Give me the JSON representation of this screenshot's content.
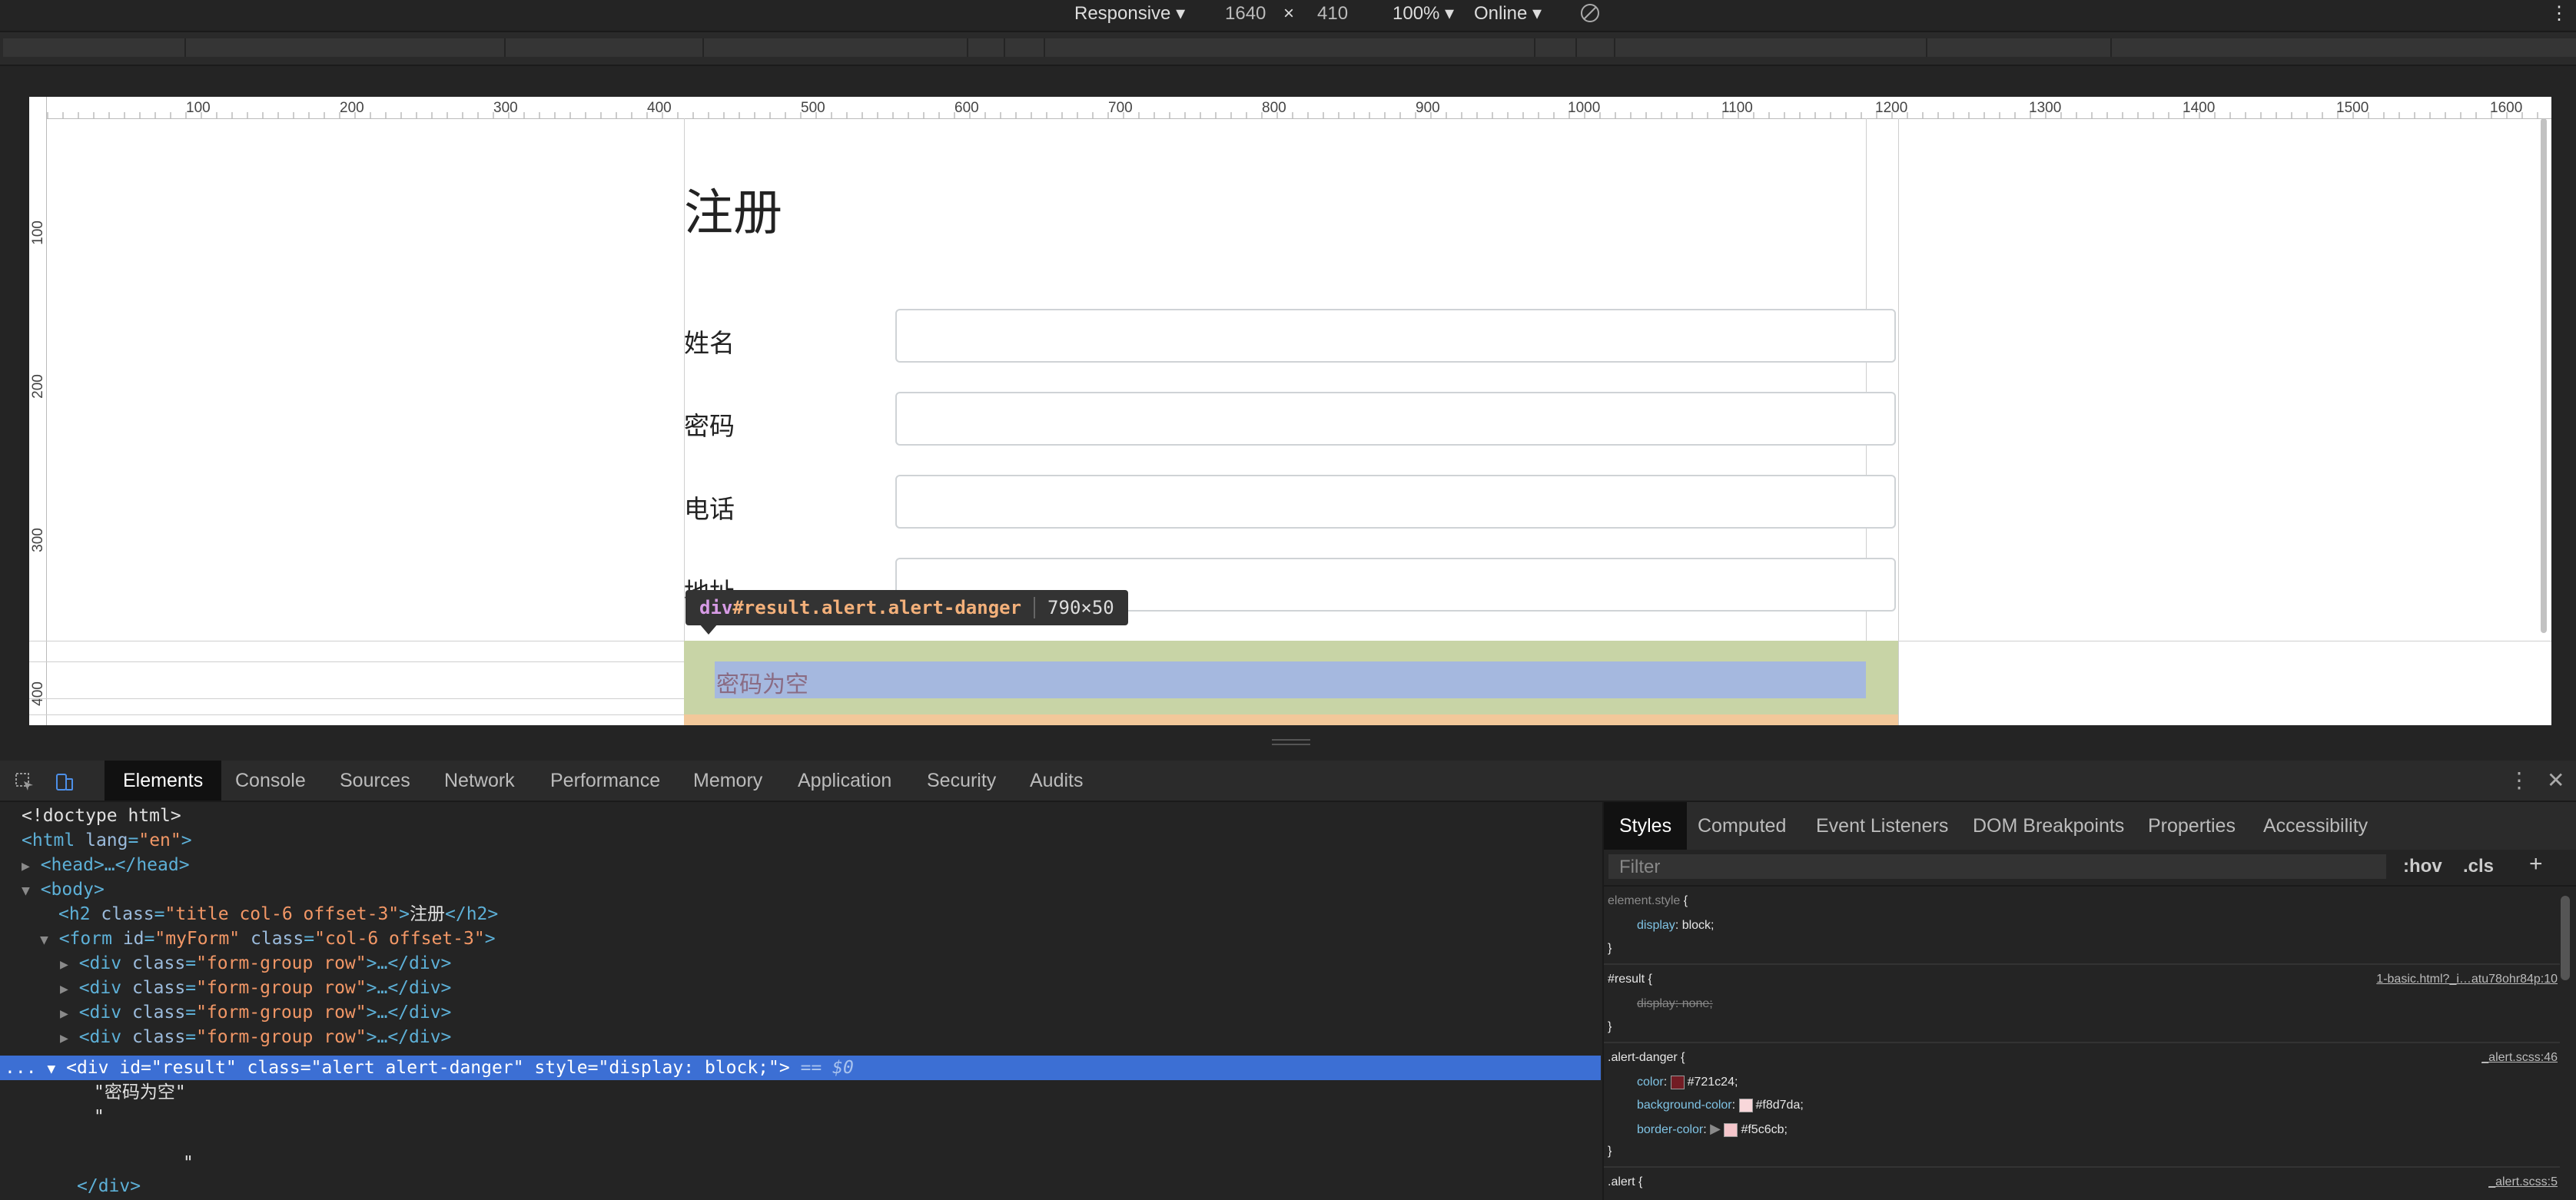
{
  "device_toolbar": {
    "device": "Responsive ▾",
    "width": "1640",
    "times": "×",
    "height": "410",
    "zoom": "100% ▾",
    "network": "Online ▾",
    "more_icon": "⋮"
  },
  "ruler": {
    "top_labels": [
      "100",
      "200",
      "300",
      "400",
      "500",
      "600",
      "700",
      "800",
      "900",
      "1000",
      "1100",
      "1200",
      "1300",
      "1400",
      "1500",
      "1600"
    ],
    "left_labels": [
      "100",
      "200",
      "300",
      "400"
    ]
  },
  "page": {
    "title": "注册",
    "fields": [
      {
        "label": "姓名"
      },
      {
        "label": "密码"
      },
      {
        "label": "电话"
      },
      {
        "label": "地址"
      }
    ],
    "alert_text": "密码为空"
  },
  "tooltip": {
    "tag": "div",
    "id_class": "#result.alert.alert-danger",
    "size": "790×50"
  },
  "devtools": {
    "tabs": [
      "Elements",
      "Console",
      "Sources",
      "Network",
      "Performance",
      "Memory",
      "Application",
      "Security",
      "Audits"
    ],
    "active_tab": "Elements",
    "close_icon": "✕",
    "menu_icon": "⋮"
  },
  "dom": {
    "doctype": "<!doctype html>",
    "html_open": "<html",
    "html_attr": "lang",
    "html_val": "\"en\"",
    "head": "<head>…</head>",
    "body": "<body>",
    "h2_open": "<h2",
    "h2_class_attr": "class",
    "h2_class_val": "\"title col-6 offset-3\"",
    "h2_text": "注册",
    "h2_close": "</h2>",
    "form_open": "<form",
    "form_id_attr": "id",
    "form_id_val": "\"myForm\"",
    "form_class_attr": "class",
    "form_class_val": "\"col-6 offset-3\"",
    "rows": [
      {
        "open": "<div",
        "attr": "class",
        "val": "\"form-group row\"",
        "rest": ">…</div>"
      },
      {
        "open": "<div",
        "attr": "class",
        "val": "\"form-group row\"",
        "rest": ">…</div>"
      },
      {
        "open": "<div",
        "attr": "class",
        "val": "\"form-group row\"",
        "rest": ">…</div>"
      },
      {
        "open": "<div",
        "attr": "class",
        "val": "\"form-group row\"",
        "rest": ">…</div>"
      }
    ],
    "selected_line": "<div id=\"result\" class=\"alert alert-danger\" style=\"display: block;\">",
    "selected_ref": "== $0",
    "text_node_1": "\"密码为空\"",
    "text_node_2": "\"",
    "text_node_3": "\"",
    "div_close": "</div>",
    "ellipsis": "..."
  },
  "styles": {
    "tabs": [
      "Styles",
      "Computed",
      "Event Listeners",
      "DOM Breakpoints",
      "Properties",
      "Accessibility"
    ],
    "filter_placeholder": "Filter",
    "hov": ":hov",
    "cls": ".cls",
    "plus": "+",
    "rules": {
      "element_style": {
        "selector": "element.style",
        "prop": "display",
        "value": "block;"
      },
      "result": {
        "selector": "#result",
        "source": "1-basic.html?_i…atu78ohr84p:10",
        "prop": "display",
        "value": "none;"
      },
      "alert_danger": {
        "selector": ".alert-danger",
        "source": "_alert.scss:46",
        "color_prop": "color",
        "color_val": "#721c24;",
        "color_hex": "#721c24",
        "bg_prop": "background-color",
        "bg_val": "#f8d7da;",
        "bg_hex": "#f8d7da",
        "border_prop": "border-color",
        "border_val": "#f5c6cb;",
        "border_hex": "#f5c6cb"
      },
      "alert": {
        "selector": ".alert",
        "source": "_alert.scss:5"
      }
    }
  }
}
